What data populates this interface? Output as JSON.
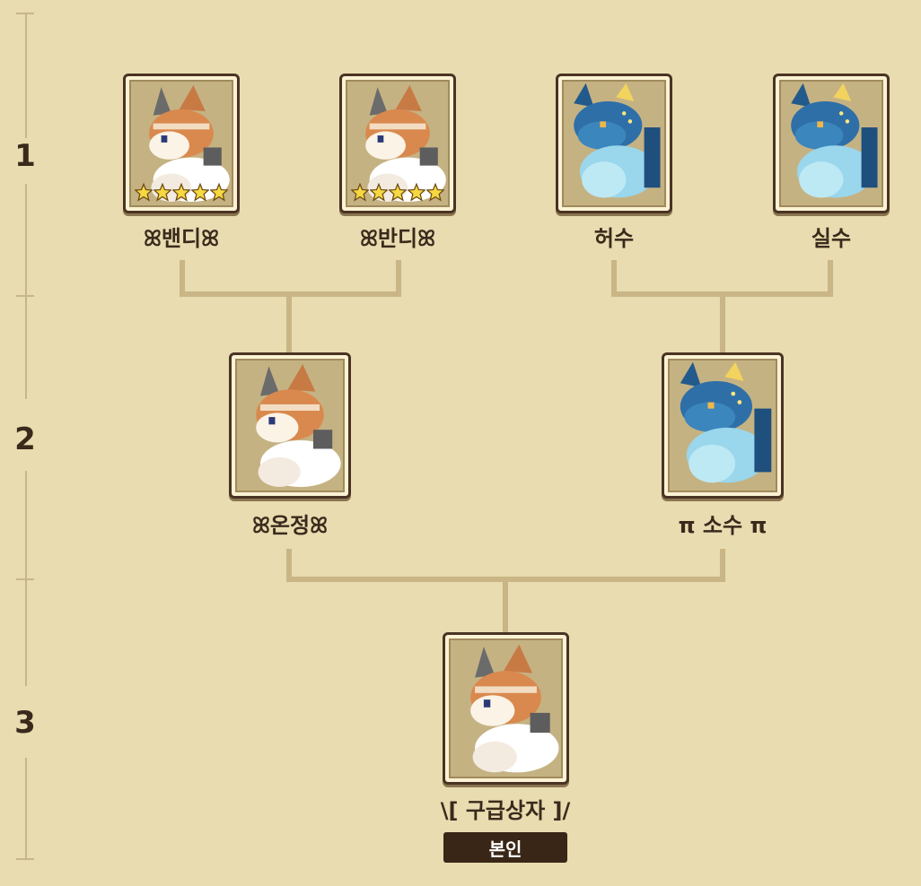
{
  "generations": [
    "1",
    "2",
    "3"
  ],
  "gen1": {
    "p1": {
      "name": "ꕤ밴디ꕤ",
      "stars": 5,
      "breed": "fox"
    },
    "p2": {
      "name": "ꕤ반디ꕤ",
      "stars": 5,
      "breed": "fox"
    },
    "p3": {
      "name": "허수",
      "stars": 0,
      "breed": "dragon"
    },
    "p4": {
      "name": "실수",
      "stars": 0,
      "breed": "dragon"
    }
  },
  "gen2": {
    "left": {
      "name": "ꕤ온정ꕤ",
      "breed": "fox"
    },
    "right": {
      "name": "π 소수 π",
      "breed": "dragon"
    }
  },
  "gen3": {
    "self": {
      "name": "\\[ 구급상자 ]/",
      "breed": "fox"
    },
    "badge": "본인"
  },
  "colors": {
    "background": "#e8dcb0",
    "connector": "#c9b585",
    "card_border": "#4a3324",
    "badge_bg": "#3a2616"
  },
  "icons": [
    "fox-creature-icon",
    "dragon-creature-icon",
    "star-icon"
  ]
}
